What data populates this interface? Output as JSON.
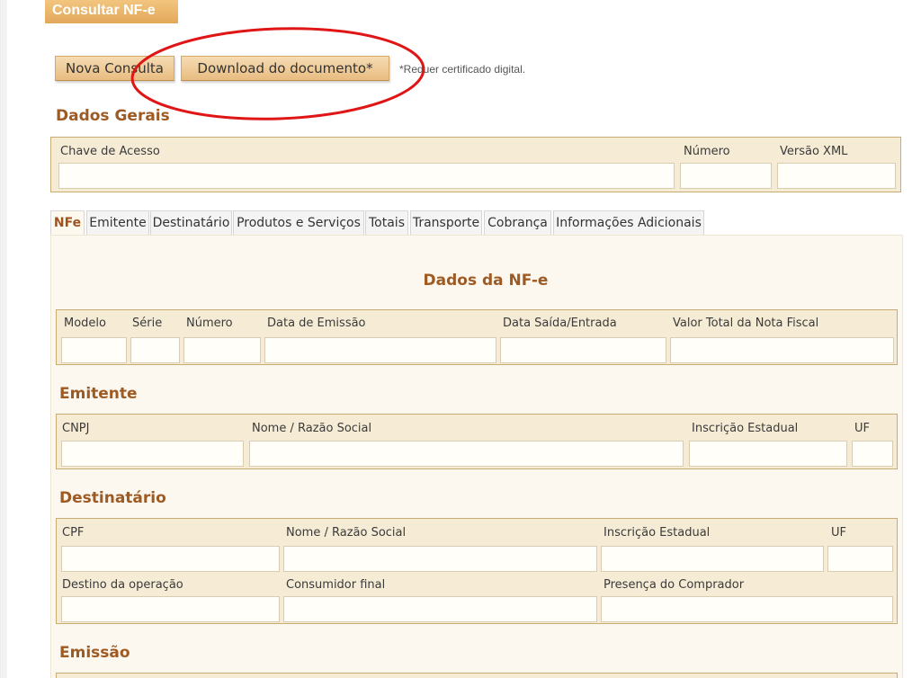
{
  "page_title": "Consultar NF-e",
  "buttons": {
    "nova_consulta": "Nova Consulta",
    "download": "Download do documento*"
  },
  "download_note": "*Requer certificado digital.",
  "dados_gerais": {
    "title": "Dados Gerais",
    "labels": {
      "chave": "Chave de Acesso",
      "numero": "Número",
      "versao": "Versão XML"
    }
  },
  "tabs": [
    "NFe",
    "Emitente",
    "Destinatário",
    "Produtos e Serviços",
    "Totais",
    "Transporte",
    "Cobrança",
    "Informações Adicionais"
  ],
  "nfe": {
    "title": "Dados da NF-e",
    "labels": {
      "modelo": "Modelo",
      "serie": "Série",
      "numero": "Número",
      "data_emissao": "Data de Emissão",
      "data_saida": "Data Saída/Entrada",
      "valor_total": "Valor Total da Nota Fiscal"
    }
  },
  "emitente": {
    "title": "Emitente",
    "labels": {
      "cnpj": "CNPJ",
      "nome": "Nome / Razão Social",
      "ie": "Inscrição Estadual",
      "uf": "UF"
    }
  },
  "destinatario": {
    "title": "Destinatário",
    "labels": {
      "cpf": "CPF",
      "nome": "Nome / Razão Social",
      "ie": "Inscrição Estadual",
      "uf": "UF",
      "destino": "Destino da operação",
      "consumidor": "Consumidor final",
      "presenca": "Presença do Comprador"
    }
  },
  "emissao": {
    "title": "Emissão"
  },
  "colors": {
    "accent": "#9e5a23",
    "box_bg": "#f6ecd6",
    "box_border": "#c8ad72",
    "annotation": "#e01515"
  }
}
